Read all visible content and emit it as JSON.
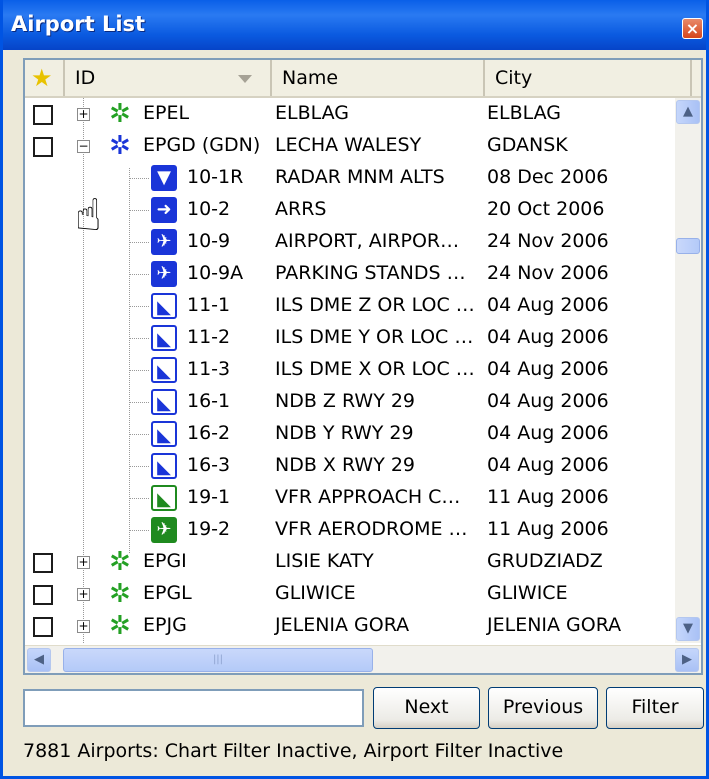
{
  "window": {
    "title": "Airport List",
    "close_label": "×"
  },
  "header": {
    "star_glyph": "★",
    "id_label": "ID",
    "name_label": "Name",
    "city_label": "City"
  },
  "airports_top": [
    {
      "id": "EPEL",
      "name": "ELBLAG",
      "city": "ELBLAG",
      "expander": "+",
      "gear_color": "green"
    },
    {
      "id": "EPGD (GDN)",
      "name": "LECHA WALESY",
      "city": "GDANSK",
      "expander": "−",
      "gear_color": "blue"
    }
  ],
  "charts": [
    {
      "id": "10-1R",
      "name": "RADAR MNM ALTS",
      "date": "08 Dec 2006",
      "icon": "radar-chart-icon",
      "icon_glyph": "▼"
    },
    {
      "id": "10-2",
      "name": "ARRS",
      "date": "20 Oct 2006",
      "icon": "arrival-chart-icon",
      "icon_glyph": "➜"
    },
    {
      "id": "10-9",
      "name": "AIRPORT, AIRPOR…",
      "date": "24 Nov 2006",
      "icon": "airport-chart-icon",
      "icon_glyph": "✈"
    },
    {
      "id": "10-9A",
      "name": "PARKING STANDS …",
      "date": "24 Nov 2006",
      "icon": "airport-chart-icon",
      "icon_glyph": "✈"
    },
    {
      "id": "11-1",
      "name": "ILS DME Z OR LOC …",
      "date": "04 Aug 2006",
      "icon": "approach-chart-icon",
      "icon_glyph": "◣"
    },
    {
      "id": "11-2",
      "name": "ILS DME Y OR LOC …",
      "date": "04 Aug 2006",
      "icon": "approach-chart-icon",
      "icon_glyph": "◣"
    },
    {
      "id": "11-3",
      "name": "ILS DME X OR LOC …",
      "date": "04 Aug 2006",
      "icon": "approach-chart-icon",
      "icon_glyph": "◣"
    },
    {
      "id": "16-1",
      "name": "NDB Z RWY 29",
      "date": "04 Aug 2006",
      "icon": "approach-chart-icon",
      "icon_glyph": "◣"
    },
    {
      "id": "16-2",
      "name": "NDB Y RWY 29",
      "date": "04 Aug 2006",
      "icon": "approach-chart-icon",
      "icon_glyph": "◣"
    },
    {
      "id": "16-3",
      "name": "NDB X RWY 29",
      "date": "04 Aug 2006",
      "icon": "approach-chart-icon",
      "icon_glyph": "◣"
    },
    {
      "id": "19-1",
      "name": "VFR APPROACH C…",
      "date": "11 Aug 2006",
      "icon": "vfr-approach-chart-icon",
      "icon_glyph": "◣"
    },
    {
      "id": "19-2",
      "name": "VFR AERODROME …",
      "date": "11 Aug 2006",
      "icon": "vfr-aerodrome-chart-icon",
      "icon_glyph": "✈"
    }
  ],
  "airports_bottom": [
    {
      "id": "EPGI",
      "name": "LISIE KATY",
      "city": "GRUDZIADZ",
      "expander": "+"
    },
    {
      "id": "EPGL",
      "name": "GLIWICE",
      "city": "GLIWICE",
      "expander": "+"
    },
    {
      "id": "EPJG",
      "name": "JELENIA GORA",
      "city": "JELENIA GORA",
      "expander": "+"
    }
  ],
  "scroll": {
    "up": "▲",
    "down": "▼",
    "left": "◀",
    "right": "▶",
    "grip": "|||"
  },
  "search": {
    "value": "",
    "placeholder": ""
  },
  "buttons": {
    "next": "Next",
    "previous": "Previous",
    "filter": "Filter"
  },
  "status": "7881 Airports: Chart Filter Inactive, Airport Filter Inactive",
  "cursor_glyph": "☝",
  "gear_glyph": "✲",
  "colors": {
    "title_bar": "#0a5fe8",
    "gear_green": "#24a024",
    "gear_blue": "#1a35d8",
    "chart_blue": "#1a35d8",
    "chart_green": "#1f8a1f"
  }
}
